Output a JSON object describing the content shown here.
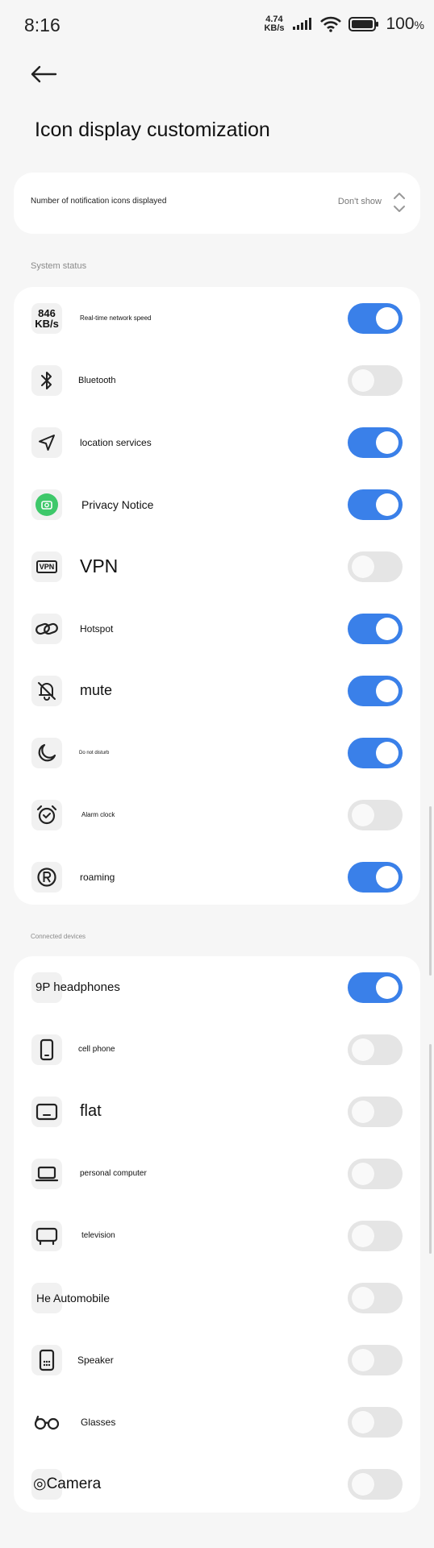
{
  "status_bar": {
    "time": "8:16",
    "net_speed_value": "4.74",
    "net_speed_unit": "KB/s",
    "battery_percent": "100",
    "percent_sign": "%"
  },
  "page": {
    "title": "Icon display customization"
  },
  "notification": {
    "label": "Number of notification icons displayed",
    "value": "Don't show"
  },
  "system_status": {
    "header": "System status",
    "items": [
      {
        "label": "Real-time network speed",
        "icon": "network-speed-icon",
        "icon_text_top": "846",
        "icon_text_bottom": "KB/s",
        "on": true
      },
      {
        "label": "Bluetooth",
        "icon": "bluetooth-icon",
        "on": false
      },
      {
        "label": "location services",
        "icon": "location-icon",
        "on": true
      },
      {
        "label": "Privacy Notice",
        "icon": "privacy-icon",
        "on": true
      },
      {
        "label": "VPN",
        "icon": "vpn-icon",
        "icon_text": "VPN",
        "on": false
      },
      {
        "label": "Hotspot",
        "icon": "hotspot-icon",
        "on": true
      },
      {
        "label": "mute",
        "icon": "mute-icon",
        "on": true
      },
      {
        "label": "Do not disturb",
        "icon": "moon-icon",
        "on": true
      },
      {
        "label": "Alarm clock",
        "icon": "alarm-clock-icon",
        "on": false
      },
      {
        "label": "roaming",
        "icon": "roaming-icon",
        "on": true
      }
    ]
  },
  "connected_devices": {
    "header": "Connected devices",
    "items": [
      {
        "label": "9P headphones",
        "icon": "headphones-icon",
        "on": true
      },
      {
        "label": "cell phone",
        "icon": "phone-icon",
        "on": false
      },
      {
        "label": "flat",
        "icon": "tablet-icon",
        "on": false
      },
      {
        "label": "personal computer",
        "icon": "laptop-icon",
        "on": false
      },
      {
        "label": "television",
        "icon": "tv-icon",
        "on": false
      },
      {
        "label": "He Automobile",
        "icon": "car-icon",
        "on": false
      },
      {
        "label": "Speaker",
        "icon": "speaker-icon",
        "on": false
      },
      {
        "label": "Glasses",
        "icon": "glasses-icon",
        "on": false
      },
      {
        "label": "◎Camera",
        "icon": "camera-icon",
        "on": false
      }
    ]
  },
  "colors": {
    "toggle_on": "#3a80e9",
    "toggle_off": "#e5e5e5",
    "privacy_green": "#3ec86a"
  }
}
